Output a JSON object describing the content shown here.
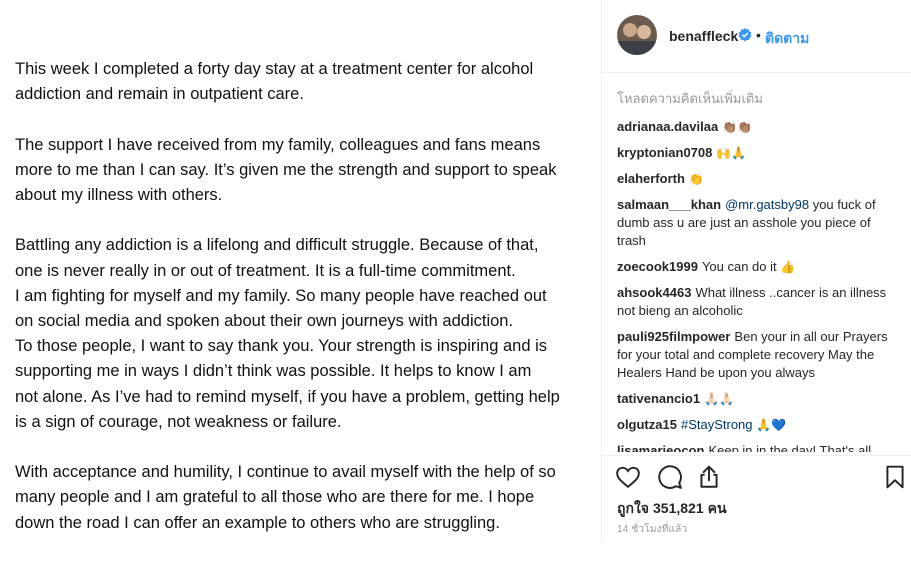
{
  "post": {
    "paragraphs": [
      "This week I completed a forty day stay at a treatment center for alcohol\naddiction and remain in outpatient care.",
      "The support I have received from my family, colleagues and fans means\nmore to me than I can say.  It’s given me the strength and support to speak\nabout my illness with others.",
      "Battling any addiction is a lifelong and difficult struggle. Because of that,\none is never really in or out of treatment. It is a full-time commitment.\nI am fighting for myself and my family. So many people have reached out\non social media and spoken about their own journeys with addiction.\nTo those people, I want to say thank you.  Your strength is inspiring and is\nsupporting me in ways I didn’t think was possible. It helps to know I am\nnot alone. As I’ve had to remind myself, if you have a problem, getting help\nis a sign of courage, not weakness or failure.",
      "With acceptance and humility, I continue to avail myself with the help of so\nmany people and I am grateful to all those who are there for me. I hope\ndown the road I can offer an example to others who are struggling."
    ]
  },
  "header": {
    "username": "benaffleck",
    "separator": "•",
    "follow_label": "ติดตาม"
  },
  "comments": {
    "load_more": "โหลดความคิดเห็นเพิ่มเติม",
    "items": [
      {
        "user": "adrianaa.davilaa",
        "mention": "",
        "text": "",
        "emoji": "👏🏽👏🏽"
      },
      {
        "user": "kryptonian0708",
        "mention": "",
        "text": "",
        "emoji": "🙌🙏"
      },
      {
        "user": "elaherforth",
        "mention": "",
        "text": "",
        "emoji": "👏"
      },
      {
        "user": "salmaan___khan",
        "mention": "@mr.gatsby98",
        "text": " you fuck of dumb ass u are just an asshole you piece of trash",
        "emoji": ""
      },
      {
        "user": "zoecook1999",
        "mention": "",
        "text": "You can do it",
        "emoji": "👍"
      },
      {
        "user": "ahsook4463",
        "mention": "",
        "text": "What illness ..cancer is an illness not bieng an alcoholic",
        "emoji": ""
      },
      {
        "user": "pauli925filmpower",
        "mention": "",
        "text": "Ben your in all our Prayers for your total and complete recovery May the Healers Hand be upon you always",
        "emoji": ""
      },
      {
        "user": "tativenancio1",
        "mention": "",
        "text": "",
        "emoji": "🙏🏻🙏🏻"
      },
      {
        "user": "olgutza15",
        "mention": "#StayStrong",
        "text": "",
        "emoji": "🙏💙"
      },
      {
        "user": "lisamarieocon",
        "mention": "",
        "text": "Keep in in the day! That's all",
        "emoji": ""
      }
    ]
  },
  "actions": {
    "like_icon": "heart-icon",
    "comment_icon": "comment-icon",
    "share_icon": "share-icon",
    "save_icon": "bookmark-icon",
    "likes_prefix": "ถูกใจ",
    "likes_count": "351,821",
    "likes_unit": "คน",
    "timestamp": "14 ชั่วโมงที่แล้ว"
  },
  "colors": {
    "link": "#3897f0",
    "verified": "#3897f0"
  }
}
